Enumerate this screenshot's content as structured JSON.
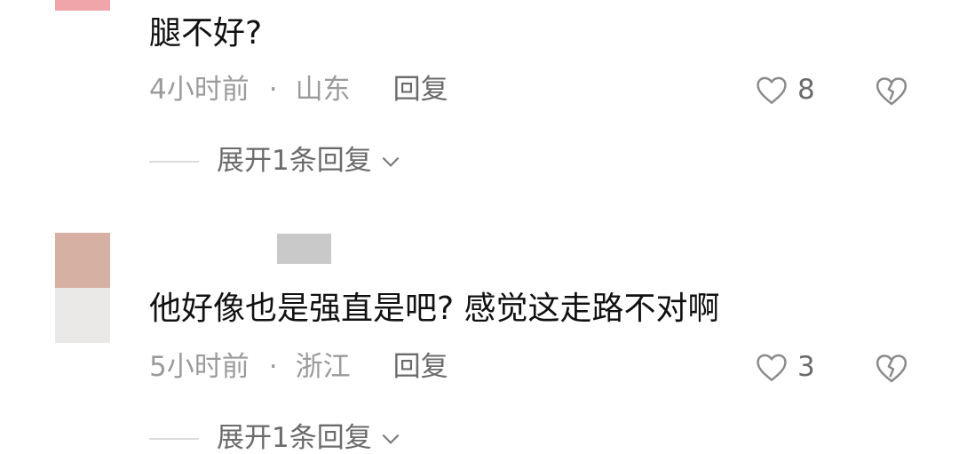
{
  "comments": [
    {
      "text": "腿不好?",
      "time": "4小时前",
      "separator": "·",
      "location": "山东",
      "reply_label": "回复",
      "like_count": "8",
      "expand_label": "展开1条回复"
    },
    {
      "text": "他好像也是强直是吧? 感觉这走路不对啊",
      "time": "5小时前",
      "separator": "·",
      "location": "浙江",
      "reply_label": "回复",
      "like_count": "3",
      "expand_label": "展开1条回复"
    }
  ],
  "icons": {
    "like": "heart-outline-icon",
    "dislike": "broken-heart-icon",
    "expand": "chevron-down-icon"
  },
  "colors": {
    "text": "#111111",
    "meta": "#9b9b9b",
    "action": "#6b6b6b",
    "avatar_top": "#f0a5aa",
    "avatar_2": "#d7b0a4"
  }
}
